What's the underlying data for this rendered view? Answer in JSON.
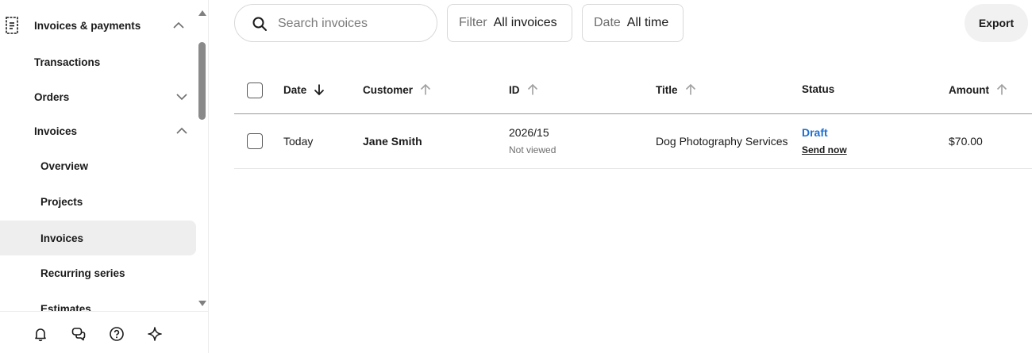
{
  "sidebar": {
    "section_title": "Invoices & payments",
    "items": [
      {
        "label": "Transactions"
      },
      {
        "label": "Orders"
      },
      {
        "label": "Invoices"
      },
      {
        "label": "Overview"
      },
      {
        "label": "Projects"
      },
      {
        "label": "Invoices"
      },
      {
        "label": "Recurring series"
      },
      {
        "label": "Estimates"
      }
    ],
    "active_item": "Invoices",
    "footer_icons": [
      "bell-icon",
      "chat-icon",
      "help-icon",
      "sparkle-icon"
    ]
  },
  "toolbar": {
    "search_placeholder": "Search invoices",
    "filter_key": "Filter",
    "filter_value": "All invoices",
    "date_key": "Date",
    "date_value": "All time",
    "export_label": "Export"
  },
  "table": {
    "columns": [
      {
        "label": "Date",
        "sort": "desc-active"
      },
      {
        "label": "Customer",
        "sort": "asc"
      },
      {
        "label": "ID",
        "sort": "asc"
      },
      {
        "label": "Title",
        "sort": "asc"
      },
      {
        "label": "Status",
        "sort": "none"
      },
      {
        "label": "Amount",
        "sort": "asc"
      }
    ],
    "rows": [
      {
        "date": "Today",
        "customer": "Jane Smith",
        "id": "2026/15",
        "id_sub": "Not viewed",
        "title": "Dog Photography Services",
        "status": "Draft",
        "status_action": "Send now",
        "amount": "$70.00"
      }
    ]
  },
  "colors": {
    "draft_status": "#1c6fd1",
    "active_nav_bg": "#eeeeee"
  }
}
